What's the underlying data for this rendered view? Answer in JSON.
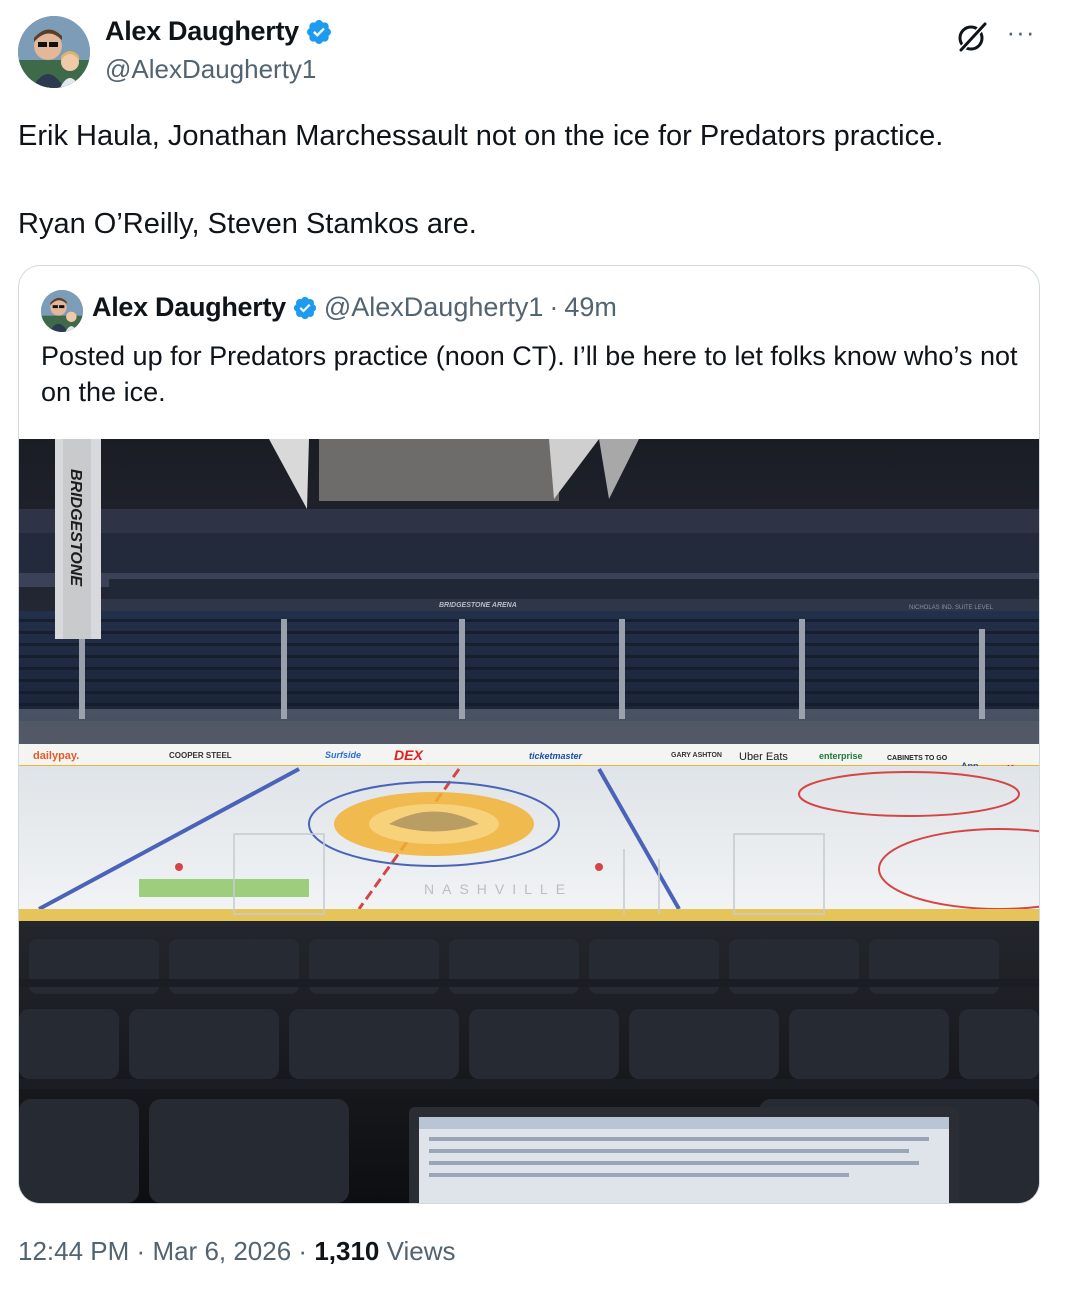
{
  "author": {
    "display_name": "Alex Daugherty",
    "handle": "@AlexDaugherty1",
    "verified": true,
    "avatar_icon": "profile-photo"
  },
  "toolbar": {
    "grok_icon": "grok-icon",
    "more_icon": "more-icon",
    "more_label": "···"
  },
  "tweet": {
    "paragraphs": [
      "Erik Haula, Jonathan Marchessault not on the ice for Predators practice.",
      "Ryan O’Reilly, Steven Stamkos are."
    ]
  },
  "quote": {
    "display_name": "Alex Daugherty",
    "handle": "@AlexDaugherty1",
    "separator": "·",
    "time": "49m",
    "text": "Posted up for Predators practice (noon CT). I’ll be here to let folks know who’s not on the ice.",
    "image": {
      "arena_signage": {
        "pillar": "BRIDGESTONE",
        "fascia": "BRIDGESTONE ARENA",
        "suite_level": "NICHOLAS IND. SUITE LEVEL",
        "boards": [
          "dailypay.",
          "COOPER STEEL",
          "Surfside",
          "DEX",
          "ticketmaster",
          "GARY ASHTON",
          "Uber Eats",
          "enterprise",
          "CABINETS TO GO",
          "App",
          "Koor"
        ],
        "ice_text": "NASHVILLE"
      }
    }
  },
  "meta": {
    "time": "12:44 PM",
    "separator": "·",
    "date": "Mar 6, 2026",
    "views_count": "1,310",
    "views_label": "Views"
  },
  "colors": {
    "verified": "#1d9bf0",
    "secondary_text": "#536471",
    "border": "#cfd9de",
    "predators_gold": "#f2b233",
    "predators_navy": "#041e42"
  }
}
